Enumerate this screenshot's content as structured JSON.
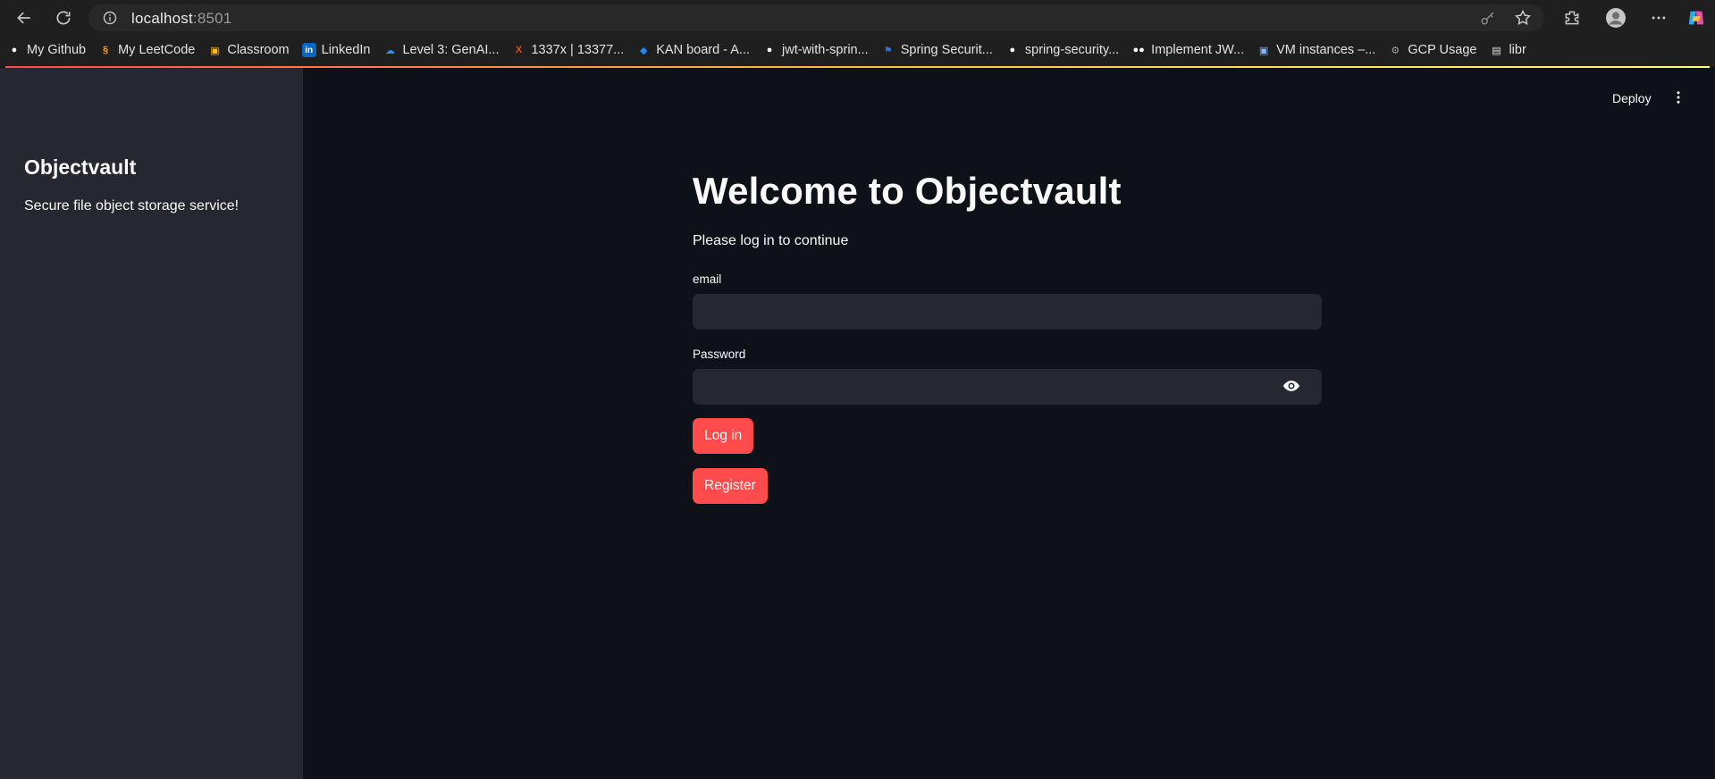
{
  "browser": {
    "url_host": "localhost",
    "url_port": ":8501",
    "bookmarks": [
      {
        "label": "My Github",
        "icon": "github-icon",
        "color": "#ffffff"
      },
      {
        "label": "My LeetCode",
        "icon": "leetcode-icon",
        "color": "#ffa116"
      },
      {
        "label": "Classroom",
        "icon": "classroom-icon",
        "color": "#fbbc04"
      },
      {
        "label": "LinkedIn",
        "icon": "linkedin-icon",
        "color": "#0a66c2"
      },
      {
        "label": "Level 3: GenAI...",
        "icon": "google-cloud-icon",
        "color": "#4285f4"
      },
      {
        "label": "1337x | 13377...",
        "icon": "x-icon",
        "color": "#e8491d"
      },
      {
        "label": "KAN board - A...",
        "icon": "jira-icon",
        "color": "#2684ff"
      },
      {
        "label": "jwt-with-sprin...",
        "icon": "github-icon",
        "color": "#ffffff"
      },
      {
        "label": "Spring Securit...",
        "icon": "bitbucket-icon",
        "color": "#2f6fdb"
      },
      {
        "label": "spring-security...",
        "icon": "github-icon",
        "color": "#ffffff"
      },
      {
        "label": "Implement JW...",
        "icon": "medium-icon",
        "color": "#ffffff"
      },
      {
        "label": "VM instances –...",
        "icon": "compute-engine-icon",
        "color": "#8ab4f8"
      },
      {
        "label": "GCP Usage",
        "icon": "gear-icon",
        "color": "#9aa0a6"
      },
      {
        "label": "libr",
        "icon": "folder-icon",
        "color": "#e3e3e3"
      }
    ]
  },
  "sidebar": {
    "title": "Objectvault",
    "description": "Secure file object storage service!"
  },
  "header": {
    "deploy_label": "Deploy"
  },
  "main": {
    "heading": "Welcome to Objectvault",
    "subtext": "Please log in to continue",
    "email_label": "email",
    "email_value": "",
    "password_label": "Password",
    "password_value": "",
    "login_label": "Log in",
    "register_label": "Register"
  },
  "colors": {
    "accent": "#ff4b4b",
    "background": "#0e1117",
    "sidebar": "#262730"
  }
}
